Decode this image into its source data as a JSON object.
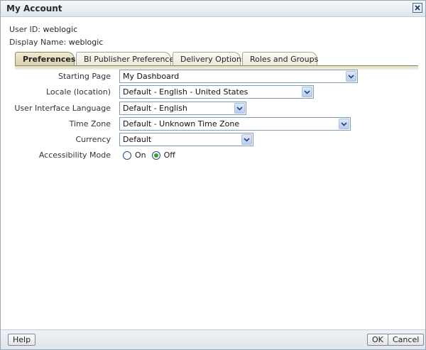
{
  "window": {
    "title": "My Account"
  },
  "user": {
    "id_label": "User ID:",
    "id_value": "weblogic",
    "display_label": "Display Name:",
    "display_value": "weblogic"
  },
  "tabs": [
    {
      "label": "Preferences",
      "active": true
    },
    {
      "label": "BI Publisher Preferences"
    },
    {
      "label": "Delivery Options"
    },
    {
      "label": "Roles and Groups"
    }
  ],
  "form": {
    "starting_page": {
      "label": "Starting Page",
      "value": "My Dashboard"
    },
    "locale": {
      "label": "Locale (location)",
      "value": "Default - English - United States"
    },
    "ui_language": {
      "label": "User Interface Language",
      "value": "Default - English"
    },
    "time_zone": {
      "label": "Time Zone",
      "value": "Default - Unknown Time Zone"
    },
    "currency": {
      "label": "Currency",
      "value": "Default"
    },
    "accessibility": {
      "label": "Accessibility Mode",
      "on_label": "On",
      "off_label": "Off",
      "selected": "Off"
    }
  },
  "footer": {
    "help_label": "Help",
    "ok_label": "OK",
    "cancel_label": "Cancel"
  }
}
